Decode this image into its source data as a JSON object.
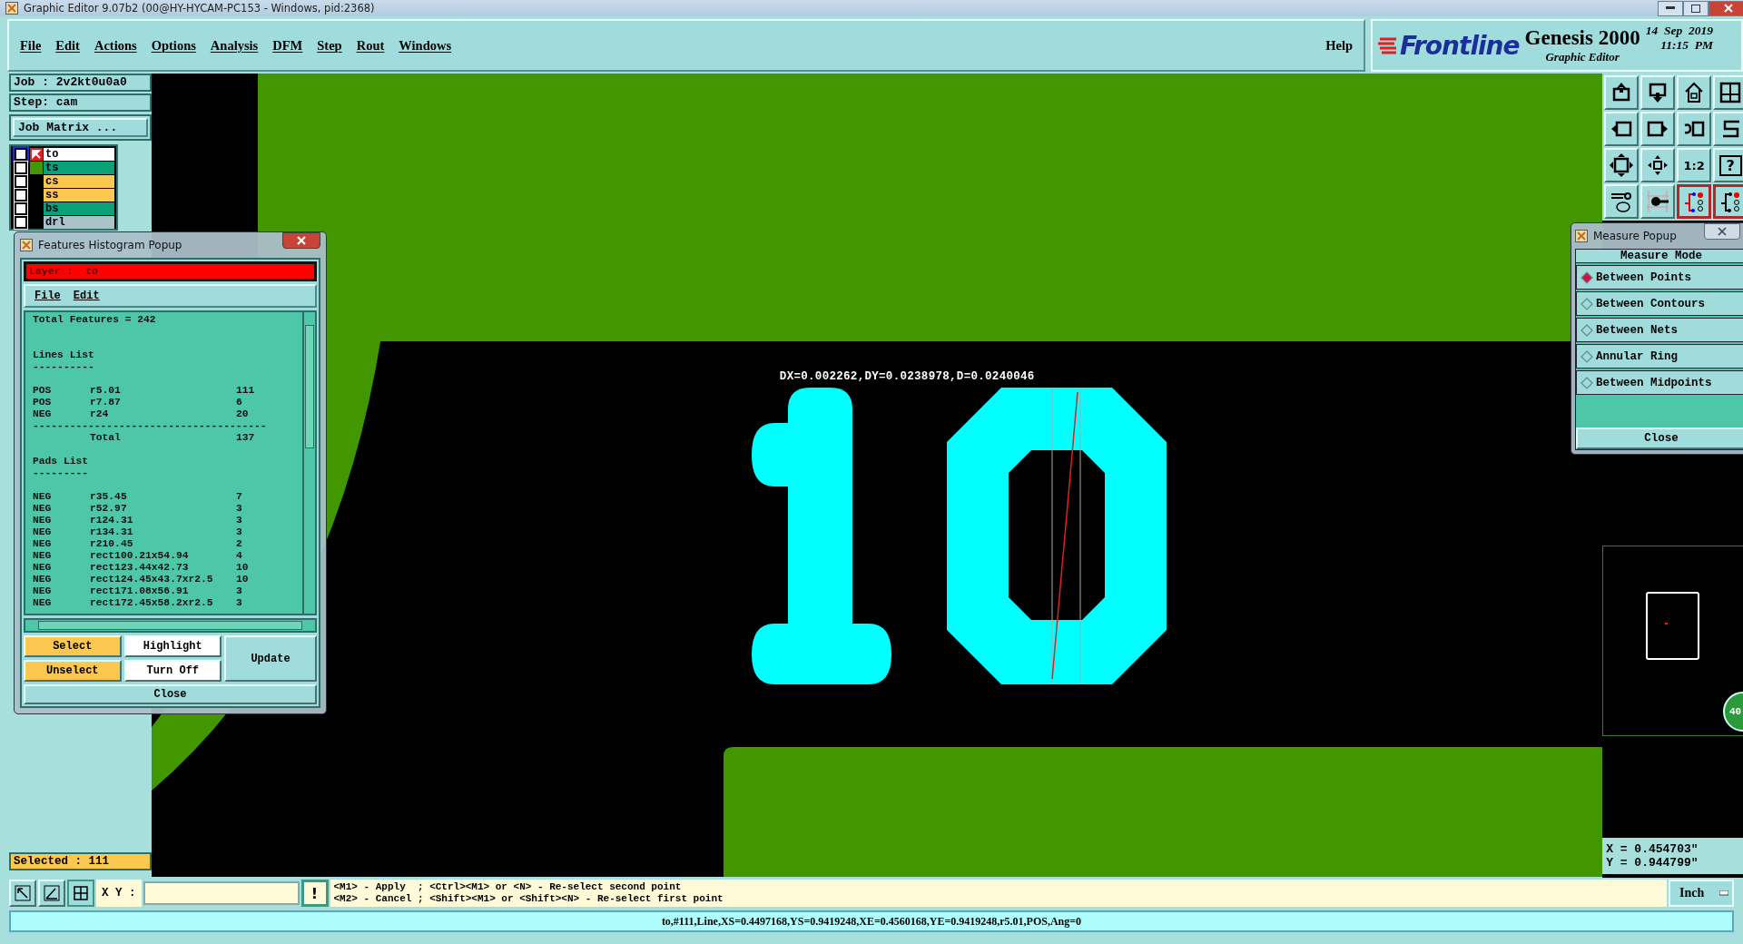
{
  "window": {
    "title": "Graphic Editor 9.07b2 (00@HY-HYCAM-PC153 - Windows, pid:2368)"
  },
  "menu": [
    {
      "label": "File"
    },
    {
      "label": "Edit"
    },
    {
      "label": "Actions"
    },
    {
      "label": "Options"
    },
    {
      "label": "Analysis"
    },
    {
      "label": "DFM"
    },
    {
      "label": "Step"
    },
    {
      "label": "Rout"
    },
    {
      "label": "Windows"
    }
  ],
  "help_menu": "Help",
  "branding": {
    "logo": "Frontline",
    "product": "Genesis 2000",
    "subtitle": "Graphic Editor",
    "date": "14  Sep  2019",
    "time": "11:15  PM"
  },
  "job": {
    "job": "Job : 2v2kt0u0a0",
    "step": "Step: cam",
    "matrix_button": "Job Matrix ..."
  },
  "layers": [
    {
      "name": "to",
      "color": "#ffffff",
      "selected": true,
      "checked": false
    },
    {
      "name": "ts",
      "color": "#0aa078",
      "selected": false,
      "checked": false
    },
    {
      "name": "cs",
      "color": "#fcc850",
      "selected": false,
      "checked": false
    },
    {
      "name": "ss",
      "color": "#fcc850",
      "selected": false,
      "checked": false
    },
    {
      "name": "bs",
      "color": "#0aa078",
      "selected": false,
      "checked": false
    },
    {
      "name": "drl",
      "color": "#a8c4c8",
      "selected": false,
      "checked": false
    }
  ],
  "selected_count": "Selected : 111",
  "histogram": {
    "title": "Features Histogram Popup",
    "layer": "Layer :  to",
    "menu": [
      "File",
      "Edit"
    ],
    "total_features": "Total Features = 242",
    "lines_heading": "Lines List",
    "lines_rule": "----------",
    "lines": [
      {
        "polarity": "POS",
        "symbol": "r5.01",
        "count": "111"
      },
      {
        "polarity": "POS",
        "symbol": "r7.87",
        "count": "6"
      },
      {
        "polarity": "NEG",
        "symbol": "r24",
        "count": "20"
      }
    ],
    "total_rule": "--------------------------------------",
    "total_label": "Total",
    "total_count": "137",
    "pads_heading": "Pads List",
    "pads_rule": "---------",
    "pads": [
      {
        "polarity": "NEG",
        "symbol": "r35.45",
        "count": "7"
      },
      {
        "polarity": "NEG",
        "symbol": "r52.97",
        "count": "3"
      },
      {
        "polarity": "NEG",
        "symbol": "r124.31",
        "count": "3"
      },
      {
        "polarity": "NEG",
        "symbol": "r134.31",
        "count": "3"
      },
      {
        "polarity": "NEG",
        "symbol": "r210.45",
        "count": "2"
      },
      {
        "polarity": "NEG",
        "symbol": "rect100.21x54.94",
        "count": "4"
      },
      {
        "polarity": "NEG",
        "symbol": "rect123.44x42.73",
        "count": "10"
      },
      {
        "polarity": "NEG",
        "symbol": "rect124.45x43.7xr2.5",
        "count": "10"
      },
      {
        "polarity": "NEG",
        "symbol": "rect171.08x56.91",
        "count": "3"
      },
      {
        "polarity": "NEG",
        "symbol": "rect172.45x58.2xr2.5",
        "count": "3"
      }
    ],
    "buttons": [
      {
        "label": "Select",
        "kind": "action"
      },
      {
        "label": "Highlight",
        "kind": "toggle"
      },
      {
        "label": "Unselect",
        "kind": "action"
      },
      {
        "label": "Turn Off",
        "kind": "toggle"
      }
    ],
    "update": "Update",
    "close": "Close"
  },
  "toolbar_text": {
    "scale": "1:2",
    "help": "?"
  },
  "measure": {
    "title": "Measure Popup",
    "heading": "Measure Mode",
    "modes": [
      {
        "label": "Between Points",
        "selected": true
      },
      {
        "label": "Between Contours",
        "selected": false
      },
      {
        "label": "Between Nets",
        "selected": false
      },
      {
        "label": "Annular Ring",
        "selected": false
      },
      {
        "label": "Between Midpoints",
        "selected": false
      }
    ],
    "close": "Close"
  },
  "canvas": {
    "measurement": "DX=0.002262,DY=0.0238978,D=0.0240046",
    "zoom_badge": "40"
  },
  "coordinates": {
    "x": "X = 0.454703\"",
    "y": "Y = 0.944799\""
  },
  "bottom": {
    "xy_label": "X Y :",
    "alert_button": "!",
    "hints": [
      "<M1> - Apply  ; <Ctrl><M1> or <N> - Re-select second point",
      "<M2> - Cancel ; <Shift><M1> or <Shift><N> - Re-select first point"
    ],
    "units": "Inch"
  },
  "status": "to,#111,Line,XS=0.4497168,YS=0.9419248,XE=0.4560168,YE=0.9419248,r5.01,POS,Ang=0"
}
